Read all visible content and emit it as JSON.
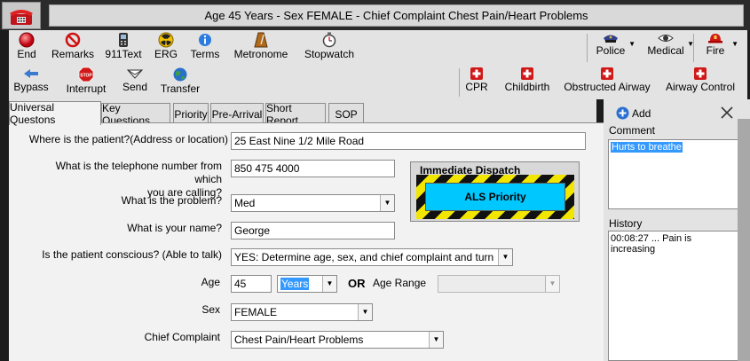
{
  "title": "Age 45 Years - Sex FEMALE - Chief Complaint Chest Pain/Heart Problems",
  "toolbar1": {
    "end": "End",
    "remarks": "Remarks",
    "text911": "911Text",
    "erg": "ERG",
    "terms": "Terms",
    "metronome": "Metronome",
    "stopwatch": "Stopwatch",
    "police": "Police",
    "medical": "Medical",
    "fire": "Fire"
  },
  "toolbar2": {
    "bypass": "Bypass",
    "interrupt": "Interrupt",
    "send": "Send",
    "transfer": "Transfer",
    "cpr": "CPR",
    "childbirth": "Childbirth",
    "obstructed_airway": "Obstructed Airway",
    "airway_control": "Airway Control"
  },
  "tabs": [
    "Universal Questons",
    "Key Questions",
    "Priority",
    "Pre-Arrival",
    "Short Report",
    "SOP"
  ],
  "form": {
    "where_label": "Where is the patient?(Address or location)",
    "where_value": "25 East Nine 1/2 Mile Road",
    "phone_label_1": "What is the telephone number from which",
    "phone_label_2": "you are calling?",
    "phone_value": "850 475 4000",
    "problem_label": "What is the problem?",
    "problem_value": "Med",
    "name_label": "What is your name?",
    "name_value": "George",
    "conscious_label": "Is the patient conscious? (Able to talk)",
    "conscious_value": "YES:  Determine age, sex, and chief complaint and turn to appr",
    "age_label": "Age",
    "age_value": "45",
    "age_unit": "Years",
    "or_label": "OR",
    "age_range_label": "Age Range",
    "age_range_value": "",
    "sex_label": "Sex",
    "sex_value": "FEMALE",
    "complaint_label": "Chief Complaint",
    "complaint_value": "Chest Pain/Heart Problems"
  },
  "dispatch": {
    "caption": "Immediate Dispatch",
    "button": "ALS Priority"
  },
  "side": {
    "add": "Add",
    "comment_label": "Comment",
    "comment_value": "Hurts to breathe",
    "history_label": "History",
    "history_entry": "00:08:27  ... Pain is increasing"
  },
  "colors": {
    "title_bg": "#2b2b2b",
    "toolbar_bg": "#e3e3e3",
    "als_button": "#00c8ff",
    "hazard_yellow": "#f2e600",
    "selection": "#3399ff"
  }
}
